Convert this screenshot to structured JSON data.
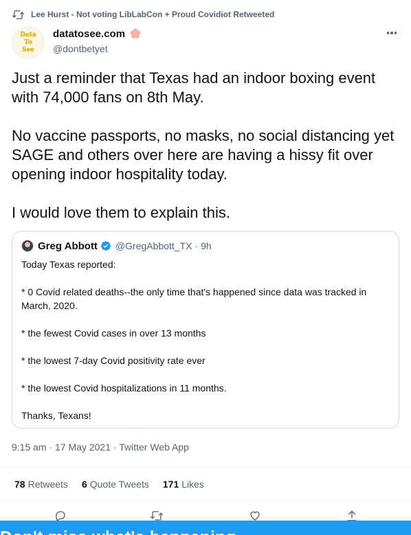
{
  "retweet_bar": {
    "label": "Lee Hurst - Not voting LibLabCon + Proud Covidiot Retweeted"
  },
  "author": {
    "avatar_text": [
      "Data",
      "To",
      "See"
    ],
    "display_name": "datatosee.com",
    "handle": "@dontbetyet"
  },
  "tweet": {
    "paragraphs": [
      "Just a reminder that Texas had an indoor boxing event with 74,000 fans on 8th May.",
      "No vaccine passports, no masks, no social distancing yet SAGE and others over here are having a hissy fit over opening indoor hospitality today.",
      "I would love them to explain this."
    ]
  },
  "quote": {
    "name": "Greg Abbott",
    "handle": "@GregAbbott_TX",
    "separator": "·",
    "time": "9h",
    "paragraphs": [
      "Today Texas reported:",
      "* 0 Covid related deaths--the only time that's happened since data was tracked in March, 2020.",
      "* the fewest Covid cases in over 13 months",
      "* the lowest 7-day Covid positivity rate ever",
      "* the lowest Covid hospitalizations in 11 months.",
      "Thanks, Texans!"
    ]
  },
  "meta": {
    "time": "9:15 am",
    "date": "17 May 2021",
    "source": "Twitter Web App",
    "sep": "·"
  },
  "stats": {
    "retweets_count": "78",
    "retweets_label": "Retweets",
    "quotes_count": "6",
    "quotes_label": "Quote Tweets",
    "likes_count": "171",
    "likes_label": "Likes"
  },
  "bottom_banner": {
    "text": "Don't miss what's happening"
  },
  "colors": {
    "accent": "#1d9bf0",
    "muted": "#536471",
    "text": "#0f1419",
    "border": "#cfd9de"
  },
  "icons": [
    "retweet-icon",
    "flower-icon",
    "more-icon",
    "verified-icon",
    "reply-icon",
    "share-icon",
    "like-icon",
    "upload-icon"
  ]
}
